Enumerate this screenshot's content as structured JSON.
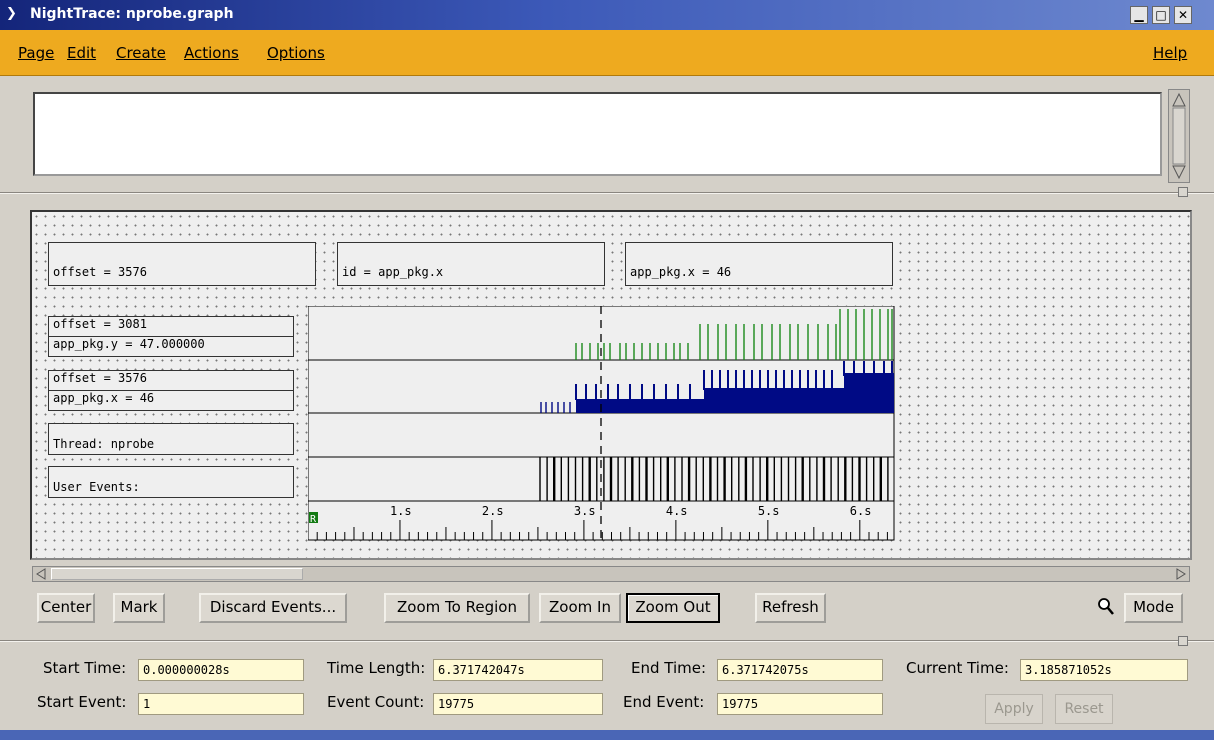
{
  "window": {
    "title": "NightTrace: nprobe.graph",
    "menu_glyph": "❯",
    "minimize": "▁",
    "maximize": "□",
    "close": "✕"
  },
  "menu": {
    "page": "Page",
    "edit": "Edit",
    "create": "Create",
    "actions": "Actions",
    "options": "Options",
    "help": "Help"
  },
  "colors": {
    "green_series": "#1a8a1a",
    "blue_series": "#000a85",
    "accent": "#eeaa1f"
  },
  "labels": {
    "box1": "offset = 3576",
    "box2": "id = app_pkg.x",
    "box3": "app_pkg.x = 46",
    "row1a": "offset = 3081",
    "row1b": "app_pkg.y = 47.000000",
    "row2a": "offset = 3576",
    "row2b": "app_pkg.x = 46",
    "row3": "Thread: nprobe",
    "row4": "User Events:"
  },
  "chart_data": {
    "type": "timeline",
    "x_ticks": [
      "1.s",
      "2.s",
      "3.s",
      "4.s",
      "5.s",
      "6.s"
    ],
    "x_range": [
      0,
      6.371742075
    ],
    "cursor_time": 3.185871052,
    "region_marker": "R"
  },
  "buttons": {
    "center": "Center",
    "mark": "Mark",
    "discard": "Discard Events...",
    "zoom_region": "Zoom To Region",
    "zoom_in": "Zoom In",
    "zoom_out": "Zoom Out",
    "refresh": "Refresh",
    "mode": "Mode",
    "apply": "Apply",
    "reset": "Reset"
  },
  "fields": {
    "start_time_label": "Start Time:",
    "start_time": "0.000000028s",
    "time_length_label": "Time Length:",
    "time_length": "6.371742047s",
    "end_time_label": "End Time:",
    "end_time": "6.371742075s",
    "current_time_label": "Current Time:",
    "current_time": "3.185871052s",
    "start_event_label": "Start Event:",
    "start_event": "1",
    "event_count_label": "Event Count:",
    "event_count": "19775",
    "end_event_label": "End Event:",
    "end_event": "19775"
  }
}
